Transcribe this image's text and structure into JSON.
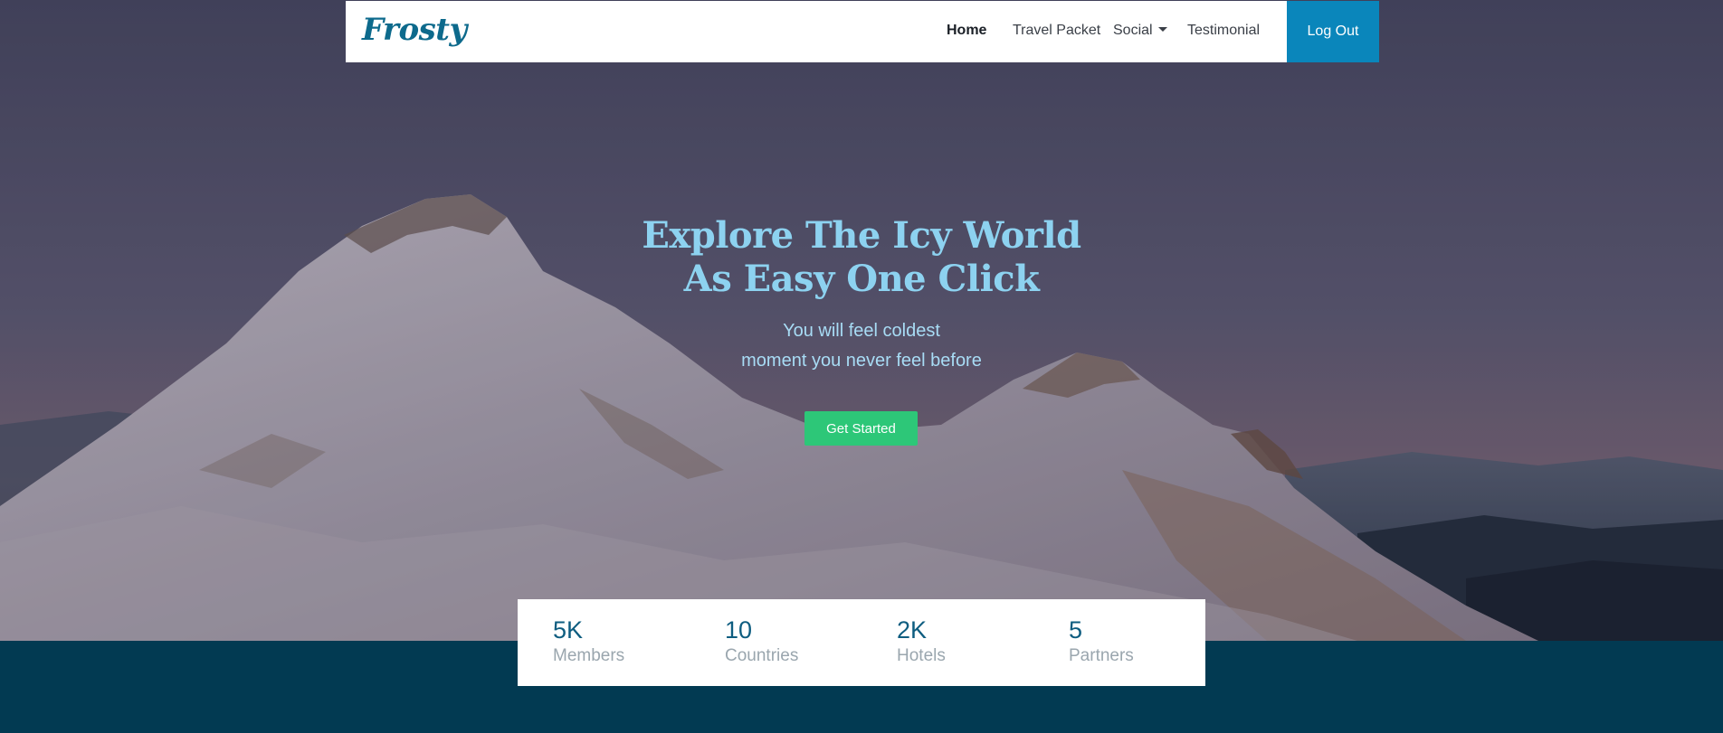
{
  "brand": {
    "logo_text": "Frosty",
    "logo_color": "#0d6a8c"
  },
  "nav": {
    "items": [
      {
        "label": "Home",
        "active": true
      },
      {
        "label": "Travel Packet",
        "active": false
      },
      {
        "label": "Social",
        "active": false,
        "has_dropdown": true
      },
      {
        "label": "Testimonial",
        "active": false
      }
    ],
    "logout_label": "Log Out",
    "logout_color": "#0a86bb"
  },
  "hero": {
    "title_line1": "Explore The Icy World",
    "title_line2": "As Easy One Click",
    "subtitle_line1": "You will feel coldest",
    "subtitle_line2": "moment you never feel before",
    "cta_label": "Get Started",
    "cta_color": "#2dc778"
  },
  "stats": [
    {
      "value": "5K",
      "label": "Members"
    },
    {
      "value": "10",
      "label": "Countries"
    },
    {
      "value": "2K",
      "label": "Hotels"
    },
    {
      "value": "5",
      "label": "Partners"
    }
  ],
  "icons": {
    "dropdown": "chevron-down-icon"
  },
  "colors": {
    "footer_band": "#023a52",
    "title": "#8dd2f0"
  }
}
